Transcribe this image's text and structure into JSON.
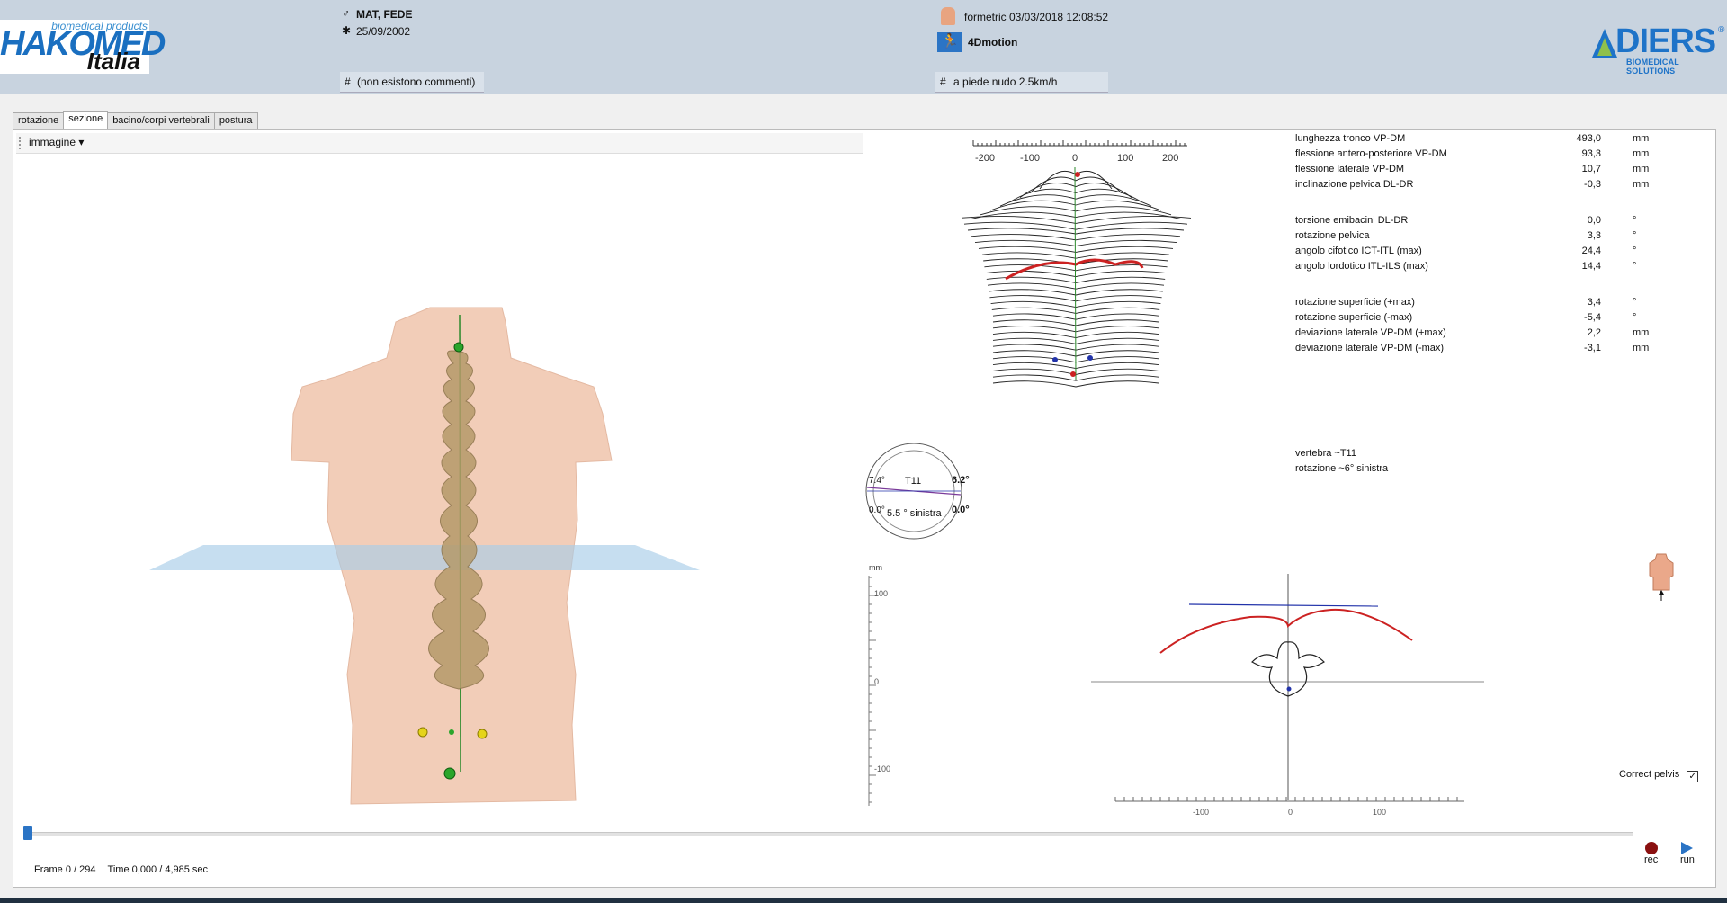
{
  "header": {
    "logo_tagline": "biomedical products",
    "logo_brand": "HAKOMED",
    "logo_sub": "Italia",
    "patient_name": "MAT, FEDE",
    "birth_date": "25/09/2002",
    "comment": "(non esistono commenti)",
    "device": "formetric 03/03/2018 12:08:52",
    "mode": "4Dmotion",
    "condition": "a piede nudo 2.5km/h",
    "diers_brand": "DIERS",
    "diers_reg": "®",
    "diers_sub": "BIOMEDICAL SOLUTIONS"
  },
  "tabs": [
    "rotazione",
    "sezione",
    "bacino/corpi vertebrali",
    "postura"
  ],
  "active_tab": "sezione",
  "toolbar": {
    "image_label": "immagine ▾"
  },
  "params": [
    {
      "label": "lunghezza tronco VP-DM",
      "value": "493,0",
      "unit": "mm"
    },
    {
      "label": "flessione antero-posteriore VP-DM",
      "value": "93,3",
      "unit": "mm"
    },
    {
      "label": "flessione laterale VP-DM",
      "value": "10,7",
      "unit": "mm"
    },
    {
      "label": "inclinazione pelvica DL-DR",
      "value": "-0,3",
      "unit": "mm"
    },
    {
      "label": "torsione emibacini DL-DR",
      "value": "0,0",
      "unit": "°"
    },
    {
      "label": "rotazione pelvica",
      "value": "3,3",
      "unit": "°"
    },
    {
      "label": "angolo cifotico ICT-ITL (max)",
      "value": "24,4",
      "unit": "°"
    },
    {
      "label": "angolo lordotico ITL-ILS (max)",
      "value": "14,4",
      "unit": "°"
    },
    {
      "label": "rotazione superficie (+max)",
      "value": "3,4",
      "unit": "°"
    },
    {
      "label": "rotazione superficie (-max)",
      "value": "-5,4",
      "unit": "°"
    },
    {
      "label": "deviazione laterale VP-DM (+max)",
      "value": "2,2",
      "unit": "mm"
    },
    {
      "label": "deviazione laterale VP-DM (-max)",
      "value": "-3,1",
      "unit": "mm"
    }
  ],
  "vertebra": {
    "line1": "vertebra  ~T11",
    "line2": "rotazione ~6° sinistra"
  },
  "compass": {
    "label": "T11",
    "left_top": "7.4°",
    "right_top": "6.2°",
    "left_bottom": "0.0°",
    "right_bottom": "0.0°",
    "caption": "5.5 ° sinistra"
  },
  "topo_ticks": [
    "-200",
    "-100",
    "0",
    "100",
    "200"
  ],
  "section_chart": {
    "y_unit": "mm",
    "y_ticks": [
      "100",
      "0",
      "-100"
    ],
    "x_ticks": [
      "-100",
      "0",
      "100"
    ]
  },
  "correct_pelvis": {
    "label": "Correct pelvis",
    "checked": "✓"
  },
  "playback": {
    "frame_text": "Frame 0 / 294",
    "time_text": "Time 0,000 / 4,985 sec",
    "rec_label": "rec",
    "run_label": "run"
  },
  "colors": {
    "accent": "#2b74c5",
    "header_bg": "#c8d3df",
    "curve_red": "#cc2222"
  }
}
